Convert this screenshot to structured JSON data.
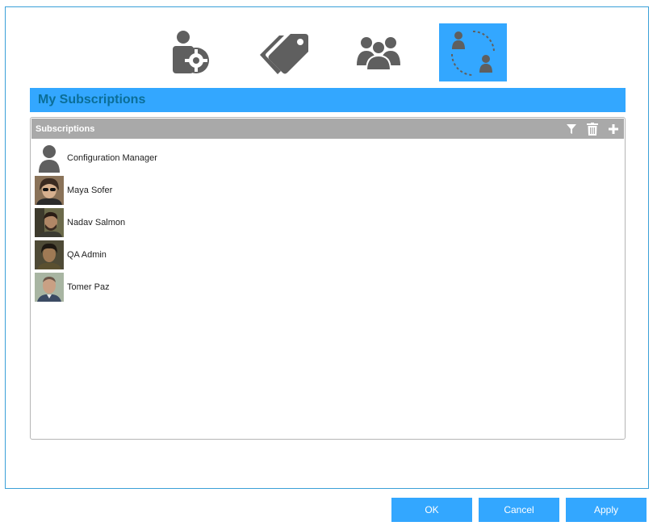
{
  "tabs": [
    {
      "icon": "user-gear-icon",
      "active": false
    },
    {
      "icon": "tags-icon",
      "active": false
    },
    {
      "icon": "users-group-icon",
      "active": false
    },
    {
      "icon": "subscriptions-cycle-icon",
      "active": true
    }
  ],
  "section": {
    "title": "My Subscriptions"
  },
  "panel": {
    "title": "Subscriptions",
    "tools": [
      "filter-icon",
      "trash-icon",
      "plus-icon"
    ],
    "items": [
      {
        "label": "Configuration Manager",
        "avatar": "default-user-icon"
      },
      {
        "label": "Maya Sofer",
        "avatar": "photo"
      },
      {
        "label": "Nadav Salmon",
        "avatar": "photo"
      },
      {
        "label": "QA Admin",
        "avatar": "photo"
      },
      {
        "label": "Tomer Paz",
        "avatar": "photo"
      }
    ]
  },
  "buttons": {
    "ok": "OK",
    "cancel": "Cancel",
    "apply": "Apply"
  },
  "colors": {
    "accent": "#33a7ff",
    "title_text": "#0b6e97",
    "panel_header": "#a9a9a9",
    "icon": "#5f5f5f"
  }
}
